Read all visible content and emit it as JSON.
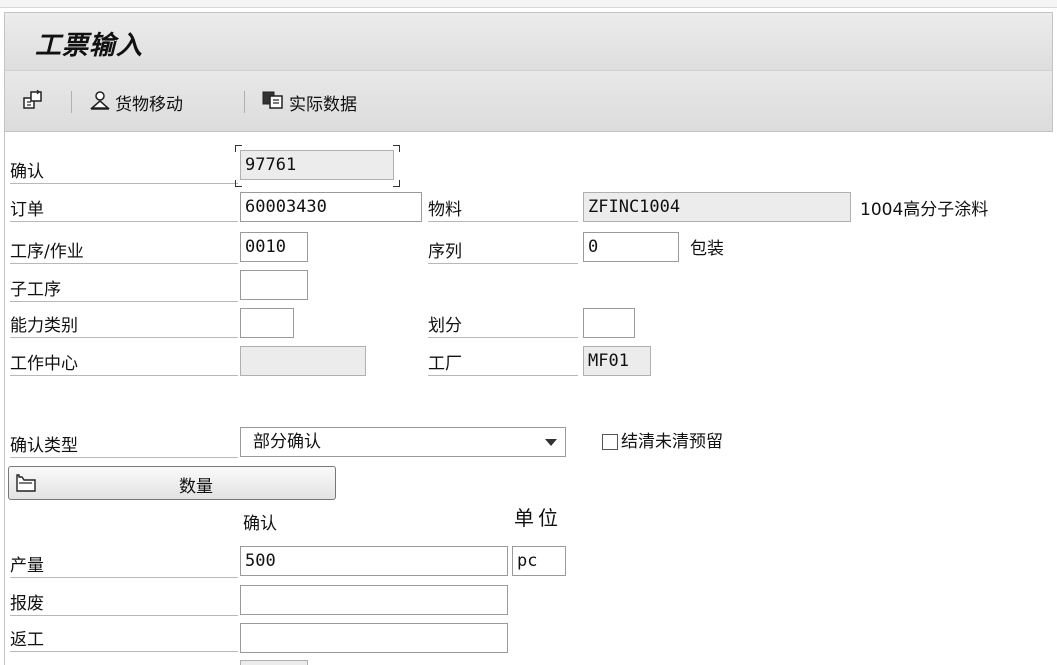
{
  "title": "工票输入",
  "toolbar": {
    "goods_movement": "货物移动",
    "actual_data": "实际数据"
  },
  "header": {
    "confirmation_label": "确认",
    "confirmation_value": "97761",
    "order_label": "订单",
    "order_value": "60003430",
    "material_label": "物料",
    "material_value": "ZFINC1004",
    "material_desc": "1004高分子涂料",
    "operation_label": "工序/作业",
    "operation_value": "0010",
    "sequence_label": "序列",
    "sequence_value": "0",
    "packaging_label": "包装",
    "suboperation_label": "子工序",
    "suboperation_value": "",
    "capacity_category_label": "能力类别",
    "capacity_category_value": "",
    "split_label": "划分",
    "split_value": "",
    "work_center_label": "工作中心",
    "work_center_value": "",
    "plant_label": "工厂",
    "plant_value": "MF01"
  },
  "confirmation_type": {
    "label": "确认类型",
    "value": "部分确认",
    "clear_reservations_label": "结清未清预留",
    "clear_reservations_checked": false
  },
  "quantities": {
    "tab_label": "数量",
    "confirm_header": "确认",
    "unit_header": "单位",
    "yield_label": "产量",
    "yield_value": "500",
    "unit_value": "pc",
    "scrap_label": "报废",
    "scrap_value": "",
    "rework_label": "返工",
    "rework_value": ""
  }
}
